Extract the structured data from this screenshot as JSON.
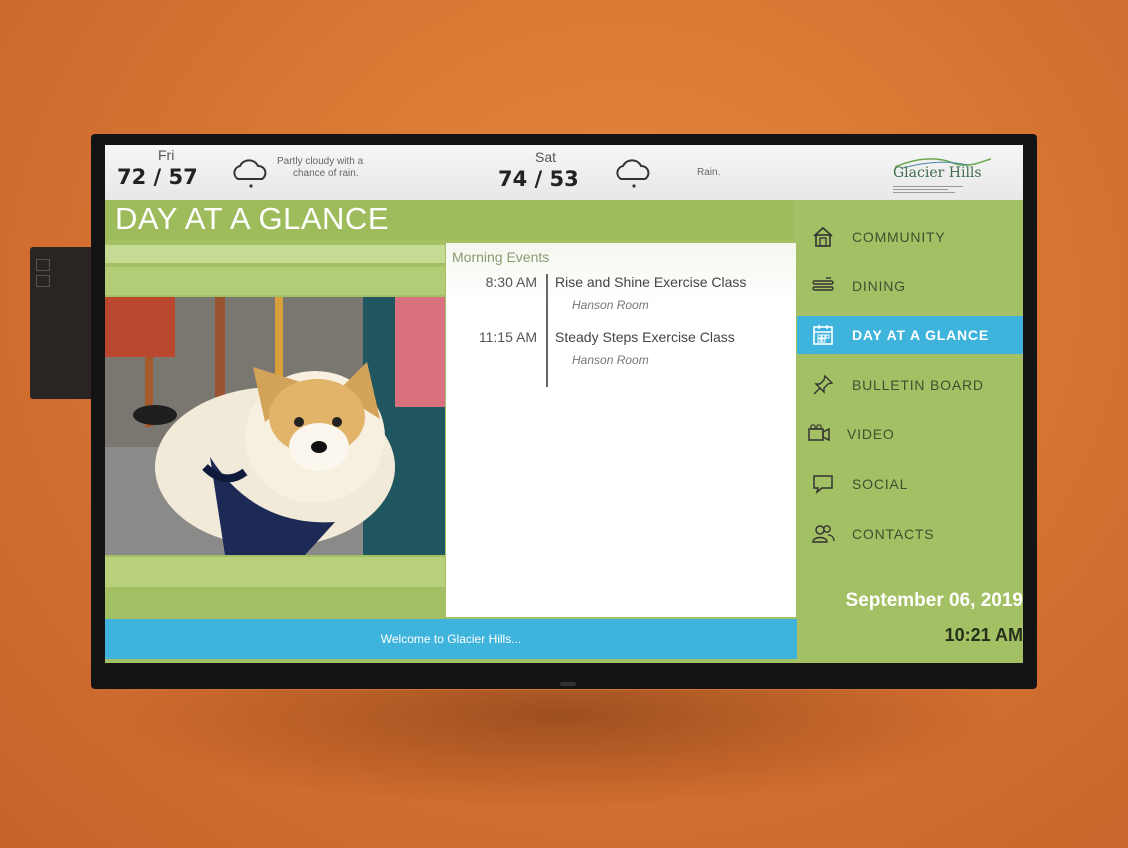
{
  "weather": {
    "day1": {
      "day": "Fri",
      "temps": "72 / 57",
      "icon": "cloud-rain-icon",
      "desc_line1": "Partly cloudy with a",
      "desc_line2": "chance of rain."
    },
    "day2": {
      "day": "Sat",
      "temps": "74 / 53",
      "icon": "cloud-rain-icon",
      "desc": "Rain."
    }
  },
  "brand": {
    "name": "Glacier Hills"
  },
  "page_title": "DAY AT A GLANCE",
  "events": {
    "heading": "Morning Events",
    "items": [
      {
        "time": "8:30 AM",
        "title": "Rise and Shine Exercise Class",
        "location": "Hanson Room"
      },
      {
        "time": "11:15 AM",
        "title": "Steady Steps Exercise Class",
        "location": "Hanson Room"
      }
    ]
  },
  "nav": {
    "items": [
      {
        "label": "COMMUNITY",
        "icon": "house-icon",
        "active": false
      },
      {
        "label": "DINING",
        "icon": "utensils-icon",
        "active": false
      },
      {
        "label": "DAY AT A GLANCE",
        "icon": "calendar-icon",
        "active": true
      },
      {
        "label": "BULLETIN BOARD",
        "icon": "pushpin-icon",
        "active": false
      },
      {
        "label": "VIDEO",
        "icon": "video-camera-icon",
        "active": false
      },
      {
        "label": "SOCIAL",
        "icon": "chat-bubble-icon",
        "active": false
      },
      {
        "label": "CONTACTS",
        "icon": "people-icon",
        "active": false
      }
    ]
  },
  "date": "September 06, 2019",
  "time": "10:21 AM",
  "ticker": "Welcome to Glacier Hills...",
  "colors": {
    "accent_blue": "#3eb4dd",
    "panel_green": "#a3c064",
    "wall_orange": "#d9742e"
  }
}
